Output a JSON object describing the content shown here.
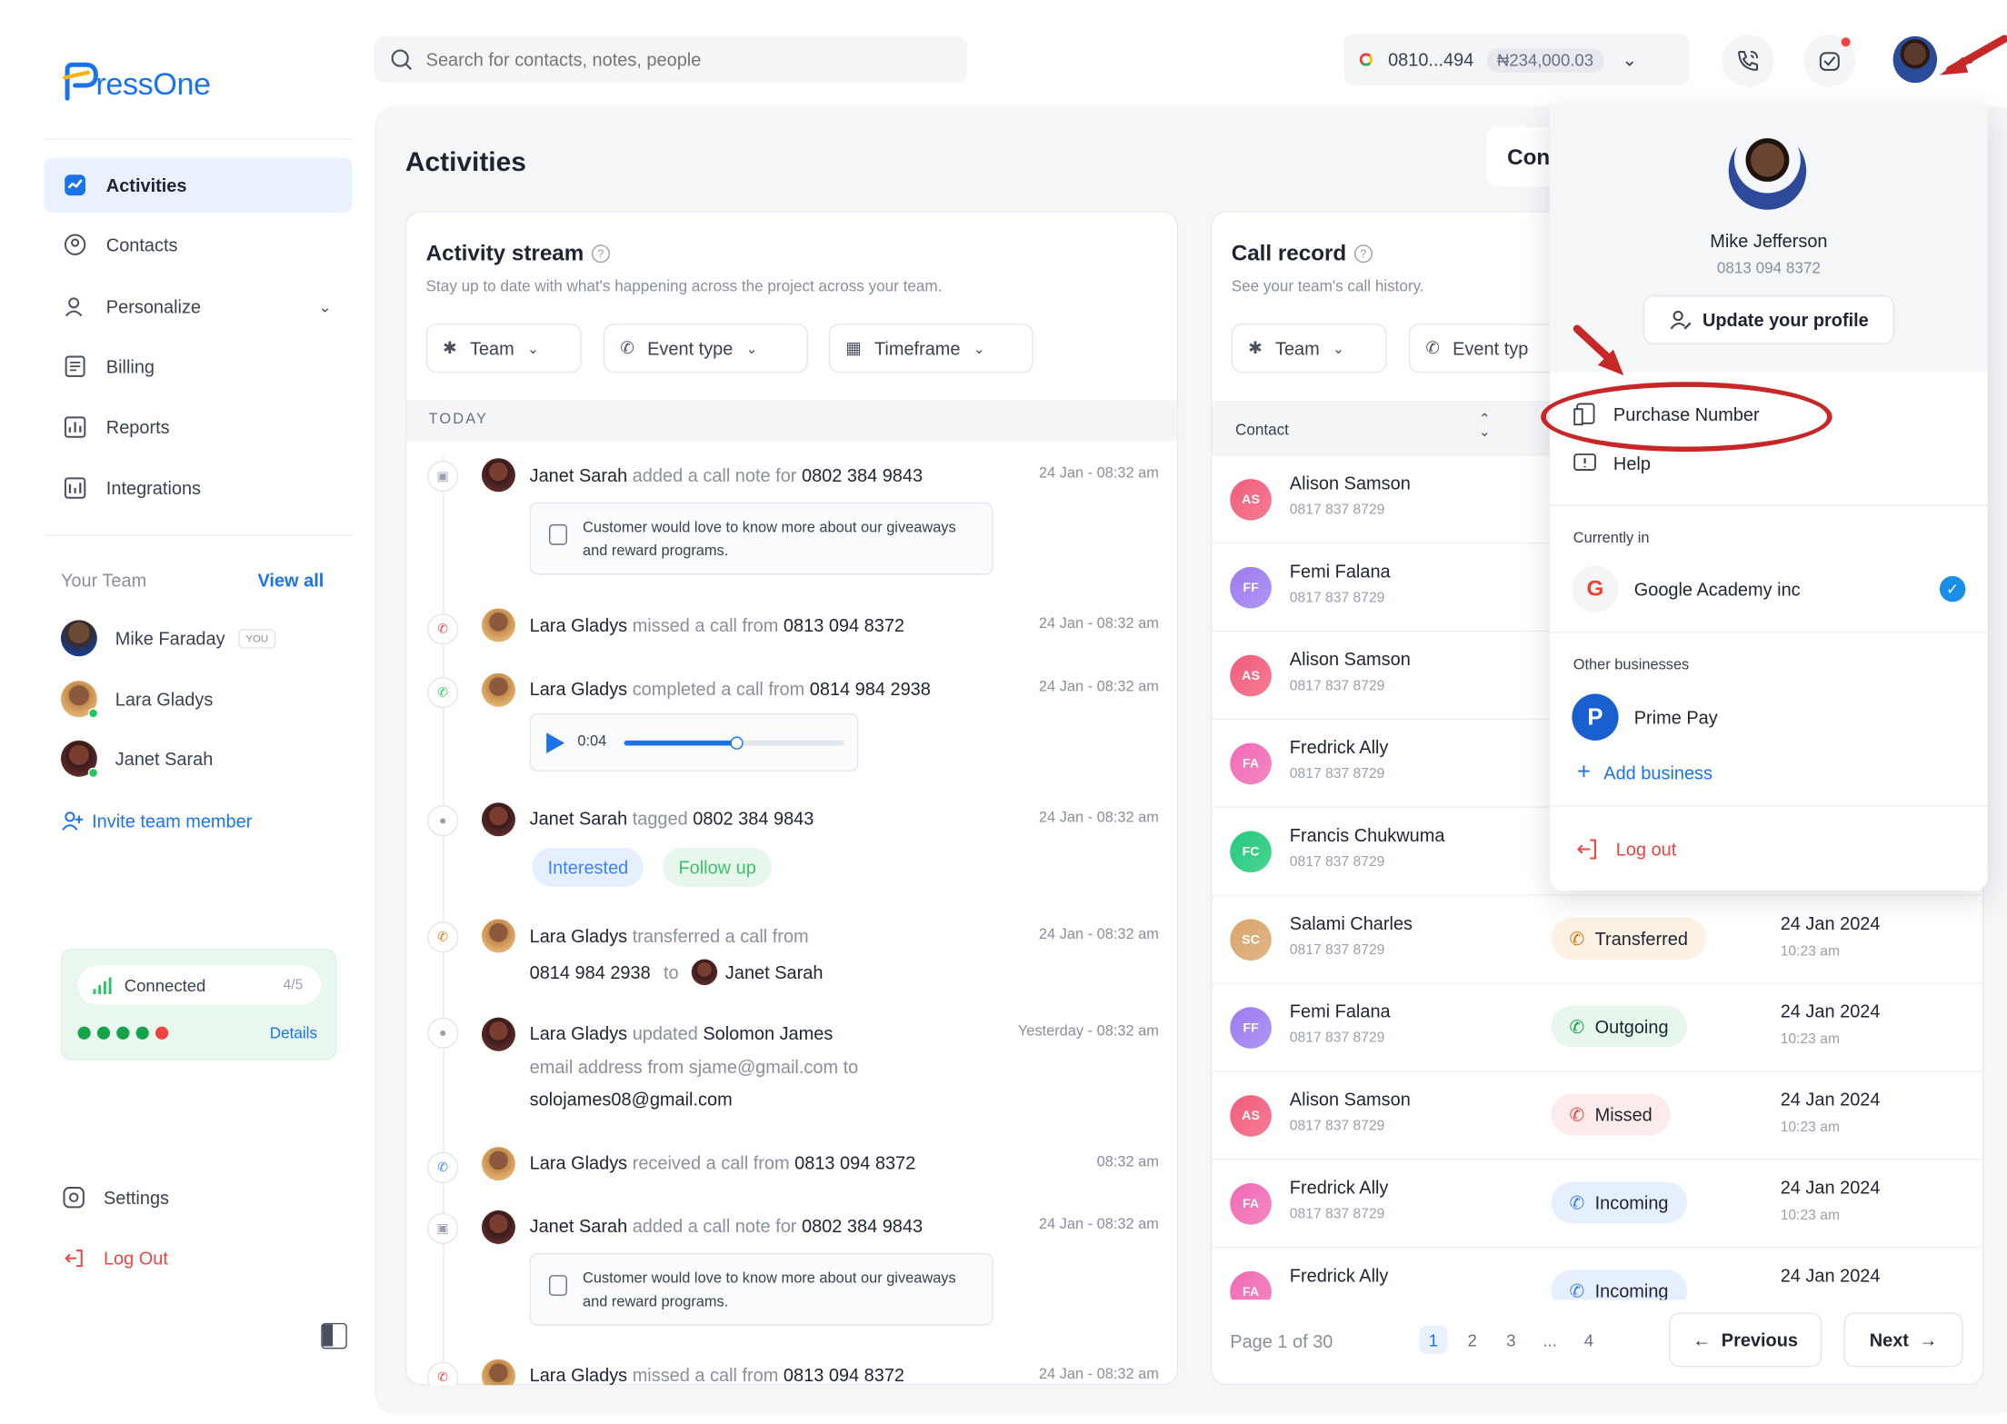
{
  "brand": {
    "logo_text": "ressOne"
  },
  "search": {
    "placeholder": "Search for contacts, notes, people"
  },
  "header": {
    "number": "0810...494",
    "balance": "₦234,000.03"
  },
  "sidebar": {
    "items": [
      {
        "label": "Activities",
        "icon": "activities-icon"
      },
      {
        "label": "Contacts",
        "icon": "contacts-icon"
      },
      {
        "label": "Personalize",
        "icon": "personalize-icon"
      },
      {
        "label": "Billing",
        "icon": "billing-icon"
      },
      {
        "label": "Reports",
        "icon": "reports-icon"
      },
      {
        "label": "Integrations",
        "icon": "integrations-icon"
      }
    ],
    "team_title": "Your Team",
    "view_all": "View all",
    "team": [
      {
        "name": "Mike Faraday",
        "badge": "YOU"
      },
      {
        "name": "Lara Gladys"
      },
      {
        "name": "Janet Sarah"
      }
    ],
    "invite": "Invite team member",
    "connection": {
      "status": "Connected",
      "count": "4/5",
      "details": "Details"
    },
    "settings": "Settings",
    "logout": "Log Out"
  },
  "page": {
    "title": "Activities",
    "contact_tab": "Con"
  },
  "activity": {
    "title": "Activity stream",
    "subtitle": "Stay up to date with what's happening across the project across your team.",
    "filters": [
      "Team",
      "Event type",
      "Timeframe"
    ],
    "section": "TODAY",
    "events": [
      {
        "actor": "Janet Sarah",
        "verb": "added a call note for",
        "target": "0802 384 9843",
        "time": "24 Jan - 08:32 am",
        "note": "Customer would love to know more about our giveaways and reward programs."
      },
      {
        "actor": "Lara Gladys",
        "verb": "missed a call from",
        "target": "0813 094 8372",
        "time": "24 Jan - 08:32 am"
      },
      {
        "actor": "Lara Gladys",
        "verb": "completed a call from",
        "target": "0814 984 2938",
        "time": "24 Jan - 08:32 am",
        "audio": "0:04"
      },
      {
        "actor": "Janet Sarah",
        "verb": "tagged",
        "target": "0802 384 9843",
        "time": "24 Jan - 08:32 am",
        "tags": [
          "Interested",
          "Follow up"
        ]
      },
      {
        "actor": "Lara Gladys",
        "verb": "transferred a call from",
        "target": "0814 984 2938",
        "to": "to",
        "to_name": "Janet Sarah",
        "time": "24 Jan - 08:32 am"
      },
      {
        "actor": "Lara Gladys",
        "verb": "updated",
        "target": "Solomon James",
        "line2_a": "email address",
        "line2_b": "from",
        "line2_c": "sjame@gmail.com",
        "line2_d": "to",
        "line3": "solojames08@gmail.com",
        "time": "Yesterday - 08:32 am"
      },
      {
        "actor": "Lara Gladys",
        "verb": "received a call from",
        "target": "0813 094 8372",
        "time": "08:32 am"
      },
      {
        "actor": "Janet Sarah",
        "verb": "added a call note for",
        "target": "0802 384 9843",
        "time": "24 Jan - 08:32 am",
        "note": "Customer would love to know more about our giveaways and reward programs."
      },
      {
        "actor": "Lara Gladys",
        "verb": "missed a call from",
        "target": "0813 094 8372",
        "time": "24 Jan - 08:32 am"
      }
    ]
  },
  "calls": {
    "title": "Call record",
    "subtitle": "See your team's call history.",
    "filters": [
      "Team",
      "Event typ"
    ],
    "col_contact": "Contact",
    "rows": [
      {
        "initials": "AS",
        "name": "Alison Samson",
        "number": "0817 837 8729",
        "color": "#f25c7a"
      },
      {
        "initials": "FF",
        "name": "Femi Falana",
        "number": "0817 837 8729",
        "color": "#9c7bf0"
      },
      {
        "initials": "AS",
        "name": "Alison Samson",
        "number": "0817 837 8729",
        "color": "#f25c7a"
      },
      {
        "initials": "FA",
        "name": "Fredrick Ally",
        "number": "0817 837 8729",
        "color": "#f06ab4"
      },
      {
        "initials": "FC",
        "name": "Francis Chukwuma",
        "number": "0817 837 8729",
        "color": "#22c97a"
      },
      {
        "initials": "SC",
        "name": "Salami Charles",
        "number": "0817 837 8729",
        "color": "#d9a56a",
        "status": "Transferred",
        "date": "24 Jan 2024",
        "time": "10:23 am"
      },
      {
        "initials": "FF",
        "name": "Femi Falana",
        "number": "0817 837 8729",
        "color": "#9c7bf0",
        "status": "Outgoing",
        "date": "24 Jan 2024",
        "time": "10:23 am"
      },
      {
        "initials": "AS",
        "name": "Alison Samson",
        "number": "0817 837 8729",
        "color": "#f25c7a",
        "status": "Missed",
        "date": "24 Jan 2024",
        "time": "10:23 am"
      },
      {
        "initials": "FA",
        "name": "Fredrick Ally",
        "number": "0817 837 8729",
        "color": "#f06ab4",
        "status": "Incoming",
        "date": "24 Jan 2024",
        "time": "10:23 am"
      },
      {
        "initials": "FA",
        "name": "Fredrick Ally",
        "number": "",
        "color": "#f06ab4",
        "status": "Incoming",
        "date": "24 Jan 2024",
        "time": ""
      }
    ],
    "pagination": {
      "label": "Page 1 of 30",
      "pages": [
        "1",
        "2",
        "3",
        "...",
        "4"
      ],
      "prev": "Previous",
      "next": "Next"
    }
  },
  "profile_menu": {
    "name": "Mike Jefferson",
    "phone": "0813 094 8372",
    "update": "Update your profile",
    "purchase": "Purchase Number",
    "help": "Help",
    "currently_in": "Currently in",
    "current_business": "Google Academy inc",
    "other_title": "Other businesses",
    "other_business": "Prime Pay",
    "add_business": "Add business",
    "logout": "Log out"
  },
  "colors": {
    "accent": "#1a73e8",
    "annotation": "#c62828",
    "connected_bg": "#e9f8ee",
    "danger": "#ef4444"
  }
}
